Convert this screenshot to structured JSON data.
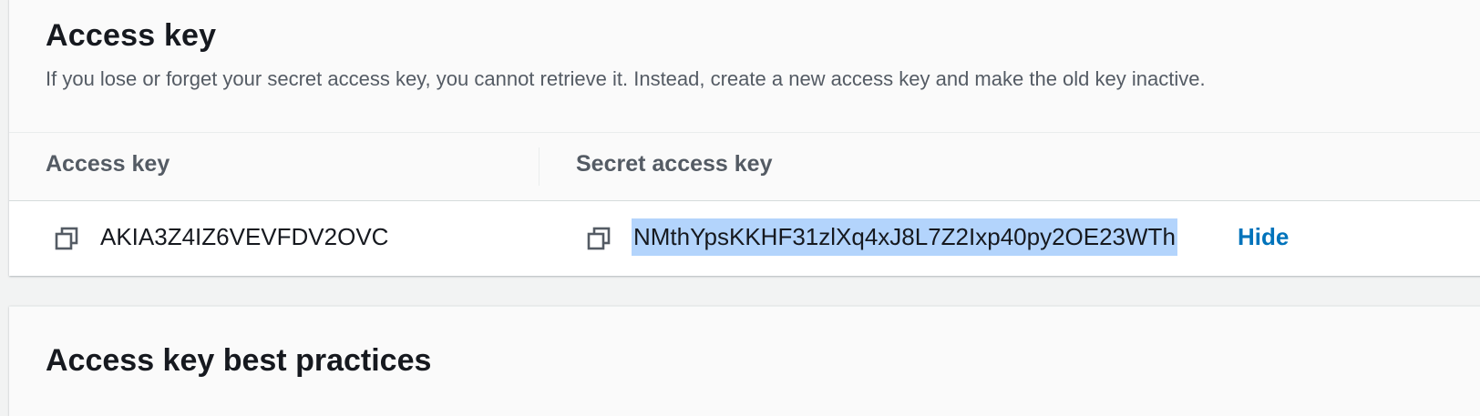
{
  "access_key_panel": {
    "title": "Access key",
    "description": "If you lose or forget your secret access key, you cannot retrieve it. Instead, create a new access key and make the old key inactive.",
    "table": {
      "headers": [
        "Access key",
        "Secret access key"
      ],
      "row": {
        "access_key": "AKIA3Z4IZ6VEVFDV2OVC",
        "secret_access_key": "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",
        "hide_label": "Hide"
      }
    },
    "icons": {
      "copy": "copy-icon"
    },
    "colors": {
      "link": "#0073bb",
      "selection": "#b3d4fc"
    }
  },
  "best_practices_panel": {
    "title": "Access key best practices"
  }
}
